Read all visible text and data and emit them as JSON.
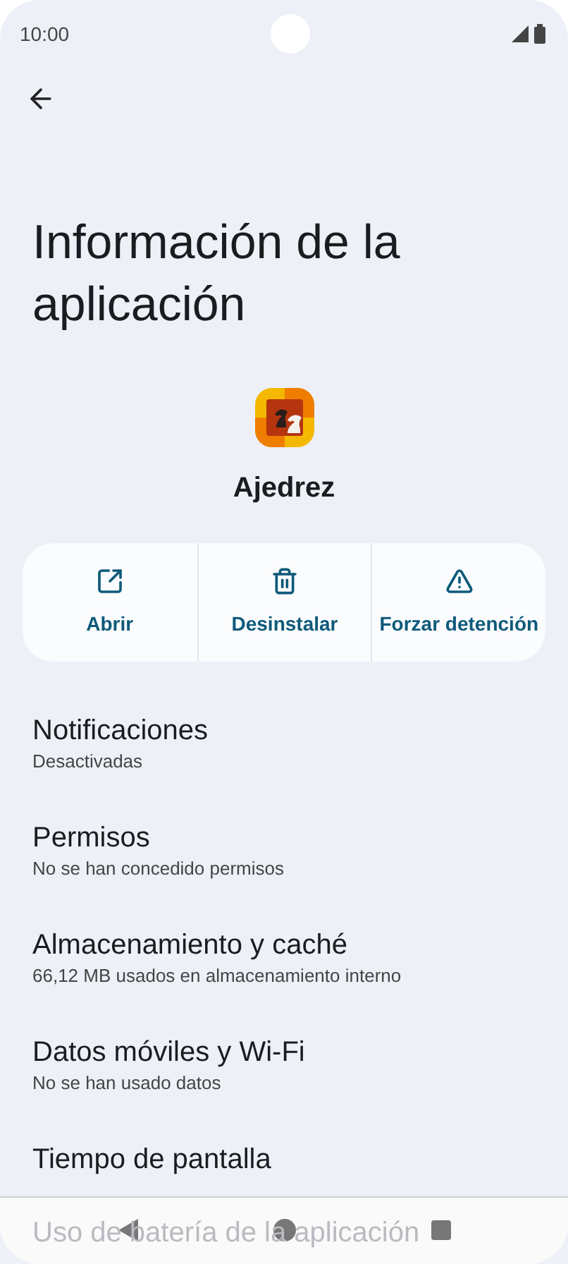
{
  "status_bar": {
    "time": "10:00"
  },
  "title": "Información de la aplicación",
  "app": {
    "name": "Ajedrez"
  },
  "actions": [
    {
      "kind": "open",
      "label": "Abrir"
    },
    {
      "kind": "uninstall",
      "label": "Desinstalar"
    },
    {
      "kind": "force_stop",
      "label": "Forzar detención"
    }
  ],
  "settings": [
    {
      "title": "Notificaciones",
      "subtitle": "Desactivadas"
    },
    {
      "title": "Permisos",
      "subtitle": "No se han concedido permisos"
    },
    {
      "title": "Almacenamiento y caché",
      "subtitle": "66,12 MB usados en almacenamiento interno"
    },
    {
      "title": "Datos móviles y Wi-Fi",
      "subtitle": "No se han usado datos"
    },
    {
      "title": "Tiempo de pantalla"
    },
    {
      "title": "Uso de batería de la aplicación"
    }
  ]
}
